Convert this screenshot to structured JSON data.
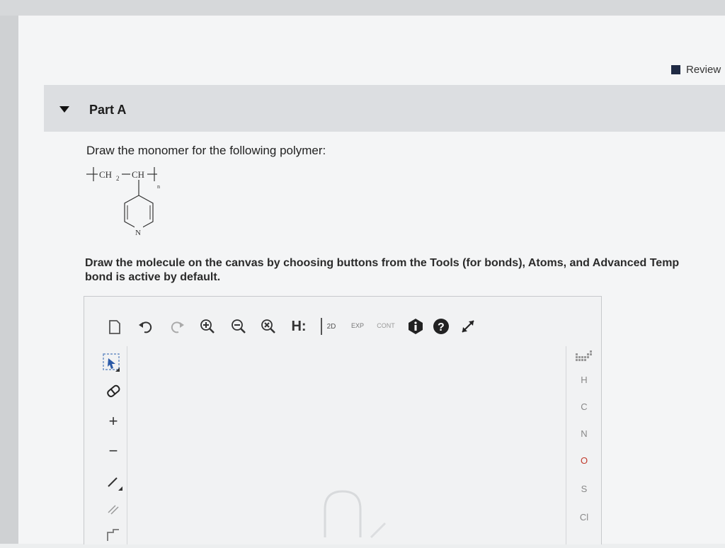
{
  "header": {
    "review_label": "Review"
  },
  "part": {
    "title": "Part A"
  },
  "question": {
    "prompt": "Draw the monomer for the following polymer:",
    "structure": {
      "ch2": "CH",
      "ch2_sub": "2",
      "ch": "CH",
      "n": "n",
      "n_atom": "N"
    }
  },
  "instructions": {
    "line1": "Draw the molecule on the canvas by choosing buttons from the Tools (for bonds), Atoms, and Advanced Temp",
    "line2": "bond is active by default."
  },
  "toolbar": {
    "h_label": "H:",
    "twod_label": "2D",
    "exp_label": "EXP",
    "cont_label": "CONT"
  },
  "left_tools": {
    "plus": "+",
    "minus": "−"
  },
  "atoms": [
    "H",
    "C",
    "N",
    "O",
    "S",
    "Cl"
  ],
  "colors": {
    "header_bg": "#dcdee1",
    "review_icon": "#1f2a44",
    "oxygen": "#c0392b",
    "toolbar_icon": "#333333"
  },
  "icons": [
    "new-document-icon",
    "undo-icon",
    "redo-icon",
    "zoom-in-icon",
    "zoom-out-icon",
    "clear-icon",
    "hydrogen-toggle-icon",
    "clean-2d-icon",
    "expand-icon",
    "contract-icon",
    "info-icon",
    "help-icon",
    "fullscreen-icon",
    "select-icon",
    "eraser-icon",
    "single-bond-icon",
    "periodic-table-icon"
  ]
}
